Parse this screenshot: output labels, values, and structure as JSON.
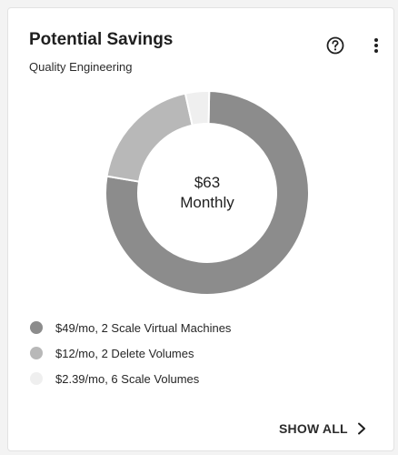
{
  "card": {
    "title": "Potential Savings",
    "subtitle": "Quality Engineering",
    "help_icon": "question-circle-icon",
    "menu_icon": "vertical-ellipsis-icon"
  },
  "chart_data": {
    "type": "pie",
    "donut": true,
    "center_value": "$63",
    "center_label": "Monthly",
    "slices": [
      {
        "label": "$49/mo, 2 Scale Virtual Machines",
        "value": 49,
        "color": "#8c8c8c"
      },
      {
        "label": "$12/mo, 2 Delete Volumes",
        "value": 12,
        "color": "#b8b8b8"
      },
      {
        "label": "$2.39/mo, 6 Scale Volumes",
        "value": 2.39,
        "color": "#efefef"
      }
    ]
  },
  "footer": {
    "show_all_label": "SHOW ALL",
    "chevron_icon": "chevron-right-icon"
  }
}
